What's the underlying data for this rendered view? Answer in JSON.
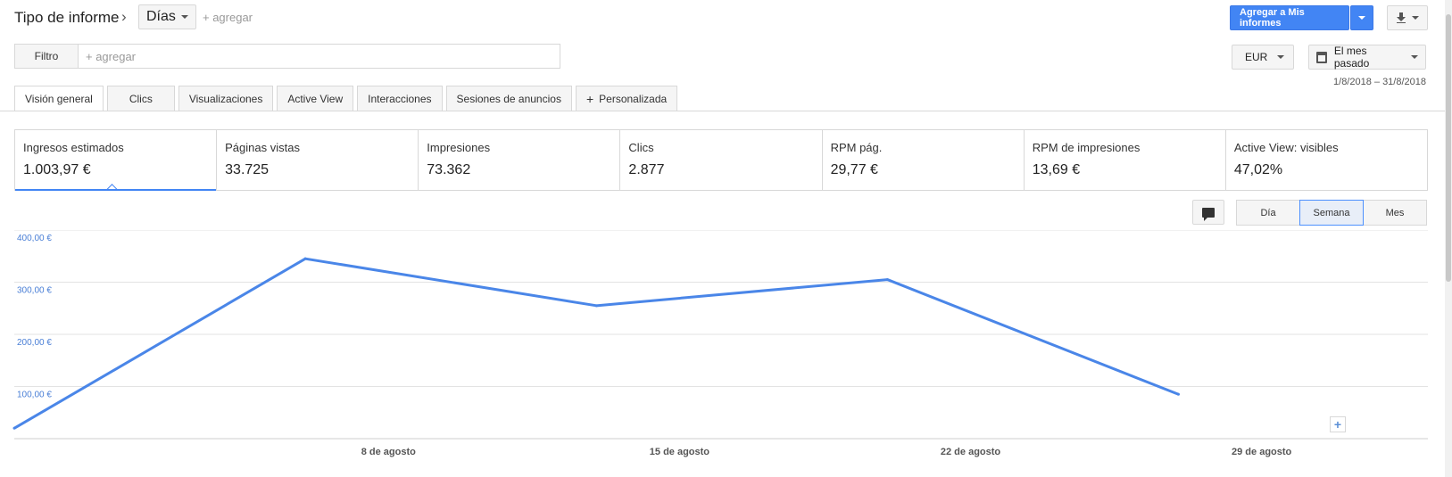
{
  "header": {
    "title": "Tipo de informe",
    "dimension": "Días",
    "add_label": "+ agregar",
    "primary_button": "Agregar a Mis informes"
  },
  "filter": {
    "label": "Filtro",
    "placeholder": "+ agregar"
  },
  "currency": "EUR",
  "date": {
    "preset": "El mes pasado",
    "range": "1/8/2018 – 31/8/2018"
  },
  "tabs": [
    "Visión general",
    "Clics",
    "Visualizaciones",
    "Active View",
    "Interacciones",
    "Sesiones de anuncios",
    "Personalizada"
  ],
  "metrics": [
    {
      "label": "Ingresos estimados",
      "value": "1.003,97 €"
    },
    {
      "label": "Páginas vistas",
      "value": "33.725"
    },
    {
      "label": "Impresiones",
      "value": "73.362"
    },
    {
      "label": "Clics",
      "value": "2.877"
    },
    {
      "label": "RPM pág.",
      "value": "29,77 €"
    },
    {
      "label": "RPM de impresiones",
      "value": "13,69 €"
    },
    {
      "label": "Active View: visibles",
      "value": "47,02%"
    }
  ],
  "periods": [
    "Día",
    "Semana",
    "Mes"
  ],
  "active_period": "Semana",
  "chart_data": {
    "type": "line",
    "y_ticks": [
      "400,00 €",
      "300,00 €",
      "200,00 €",
      "100,00 €"
    ],
    "x_ticks": [
      "8 de agosto",
      "15 de agosto",
      "22 de agosto",
      "29 de agosto"
    ],
    "ylim": [
      0,
      400
    ],
    "color": "#4a86e8",
    "series": [
      {
        "x": [
          "2018-07-30",
          "2018-08-06",
          "2018-08-13",
          "2018-08-20",
          "2018-08-27"
        ],
        "values": [
          20,
          345,
          255,
          305,
          85
        ]
      }
    ]
  }
}
